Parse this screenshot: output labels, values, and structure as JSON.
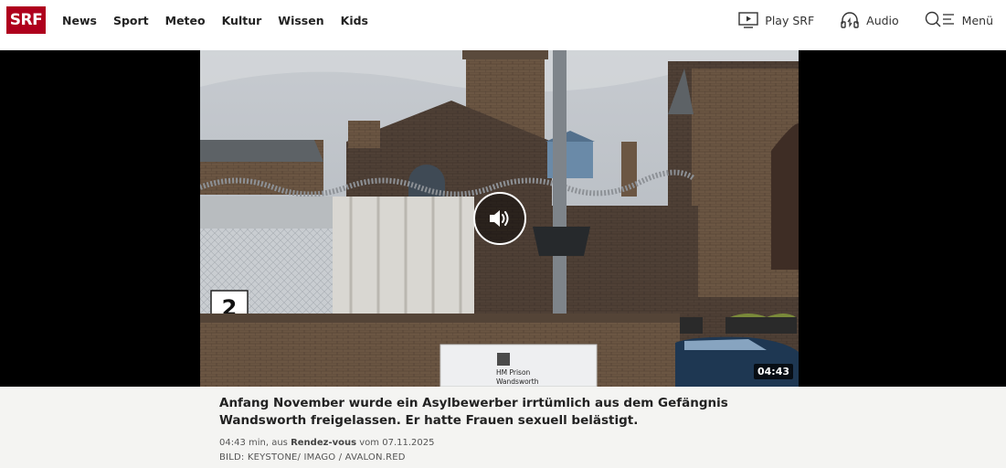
{
  "header": {
    "logo": "SRF",
    "nav": [
      "News",
      "Sport",
      "Meteo",
      "Kultur",
      "Wissen",
      "Kids"
    ],
    "play_label": "Play SRF",
    "audio_label": "Audio",
    "menu_label": "Menü"
  },
  "video": {
    "duration": "04:43",
    "sign_line1": "HM Prison",
    "sign_line2": "Wandsworth",
    "number": "2"
  },
  "caption": {
    "text": "Anfang November wurde ein Asylbewerber irrtümlich aus dem Gefängnis Wandsworth freigelassen. Er hatte Frauen sexuell belästigt.",
    "length": "04:43 min, aus",
    "show": "Rendez-vous",
    "date_prefix": "vom",
    "date": "07.11.2025",
    "credit": "BILD: KEYSTONE/ IMAGO / AVALON.RED"
  }
}
